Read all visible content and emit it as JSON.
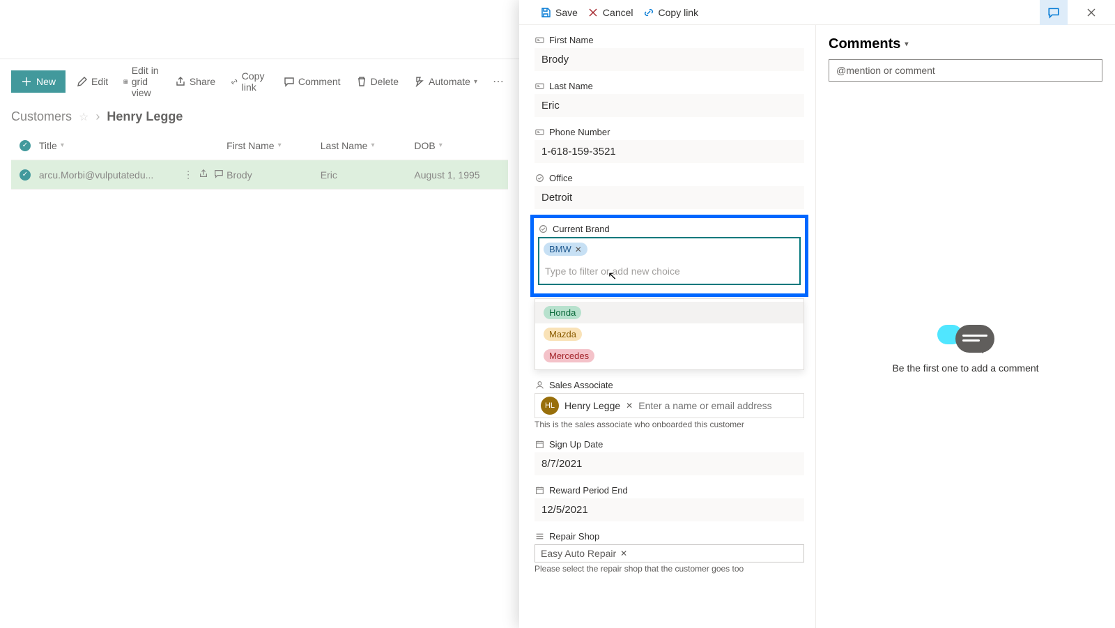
{
  "toolbar": {
    "new": "New",
    "edit": "Edit",
    "edit_grid": "Edit in grid view",
    "share": "Share",
    "copy_link": "Copy link",
    "comment": "Comment",
    "delete": "Delete",
    "automate": "Automate"
  },
  "breadcrumb": {
    "root": "Customers",
    "current": "Henry Legge"
  },
  "grid": {
    "columns": {
      "title": "Title",
      "first_name": "First Name",
      "last_name": "Last Name",
      "dob": "DOB"
    },
    "rows": [
      {
        "title": "arcu.Morbi@vulputatedu...",
        "first_name": "Brody",
        "last_name": "Eric",
        "dob": "August 1, 1995"
      }
    ]
  },
  "panel_actions": {
    "save": "Save",
    "cancel": "Cancel",
    "copy_link": "Copy link"
  },
  "form": {
    "first_name": {
      "label": "First Name",
      "value": "Brody"
    },
    "last_name": {
      "label": "Last Name",
      "value": "Eric"
    },
    "phone": {
      "label": "Phone Number",
      "value": "1-618-159-3521"
    },
    "office": {
      "label": "Office",
      "value": "Detroit"
    },
    "current_brand": {
      "label": "Current Brand",
      "selected": "BMW",
      "filter_placeholder": "Type to filter or add new choice",
      "options": [
        "Honda",
        "Mazda",
        "Mercedes"
      ]
    },
    "sales_associate": {
      "label": "Sales Associate",
      "initials": "HL",
      "name": "Henry Legge",
      "placeholder": "Enter a name or email address",
      "helper": "This is the sales associate who onboarded this customer"
    },
    "sign_up": {
      "label": "Sign Up Date",
      "value": "8/7/2021"
    },
    "reward_end": {
      "label": "Reward Period End",
      "value": "12/5/2021"
    },
    "repair_shop": {
      "label": "Repair Shop",
      "value": "Easy Auto Repair",
      "helper": "Please select the repair shop that the customer goes too"
    }
  },
  "comments": {
    "title": "Comments",
    "placeholder": "@mention or comment",
    "empty": "Be the first one to add a comment"
  }
}
